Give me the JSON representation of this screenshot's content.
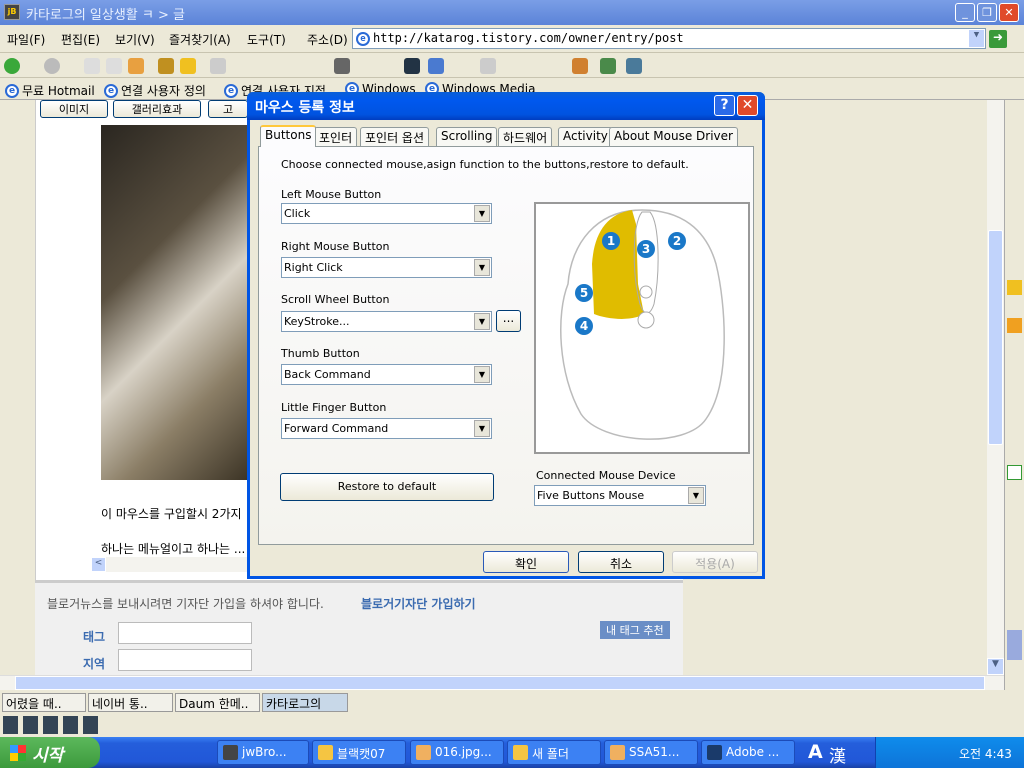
{
  "window": {
    "title": "카타로그의 일상생활 ㅋ > 글",
    "app_icon": "jB"
  },
  "menu": [
    "파일(F)",
    "편집(E)",
    "보기(V)",
    "즐겨찾기(A)",
    "도구(T)"
  ],
  "address": {
    "label": "주소(D)",
    "url": "http://katarog.tistory.com/owner/entry/post"
  },
  "links": [
    "무료 Hotmail",
    "연결 사용자 정의",
    "연결 사용자 지정",
    "Windows",
    "Windows Media"
  ],
  "blog": {
    "editor_tabs": [
      "이미지",
      "갤러리효과",
      "고"
    ],
    "text1": "이 마우스를 구입할시 2가지",
    "text2": "하나는 메뉴얼이고 하나는 ...",
    "news_notice": "블로거뉴스를 보내시려면 기자단 가입을 하셔야 합니다.",
    "join_link": "블로거기자단 가입하기",
    "tag_label": "태그",
    "region_label": "지역",
    "tag_recommend": "내 태그 추천",
    "tag_value": "",
    "region_value": ""
  },
  "browser_tabs": [
    "어렸을 때..",
    "네이버 통..",
    "Daum 한메..",
    "카타로그의"
  ],
  "dialog": {
    "title": "마우스 등록 정보",
    "tabs": [
      "Buttons",
      "포인터",
      "포인터 옵션",
      "Scrolling",
      "하드웨어",
      "Activity",
      "About Mouse Driver"
    ],
    "active_tab": "Buttons",
    "description": "Choose connected mouse,asign function to the buttons,restore to default.",
    "fields": [
      {
        "label": "Left Mouse Button",
        "value": "Click"
      },
      {
        "label": "Right Mouse Button",
        "value": "Right Click"
      },
      {
        "label": "Scroll Wheel Button",
        "value": "KeyStroke..."
      },
      {
        "label": "Thumb Button",
        "value": "Back Command"
      },
      {
        "label": "Little Finger Button",
        "value": "Forward Command"
      }
    ],
    "more_button": "...",
    "restore_button": "Restore to default",
    "device_label": "Connected Mouse Device",
    "device_value": "Five Buttons Mouse",
    "mouse_numbers": [
      "1",
      "2",
      "3",
      "4",
      "5"
    ],
    "highlight_color": "#e0bc00",
    "ok": "확인",
    "cancel": "취소",
    "apply": "적용(A)"
  },
  "taskbar": {
    "start": "시작",
    "tasks": [
      "jwBro...",
      "블랙캣07",
      "016.jpg...",
      "새 폴더",
      "SSA51...",
      "Adobe ..."
    ],
    "ime": [
      "A",
      "漢"
    ],
    "clock": "오전 4:43"
  }
}
